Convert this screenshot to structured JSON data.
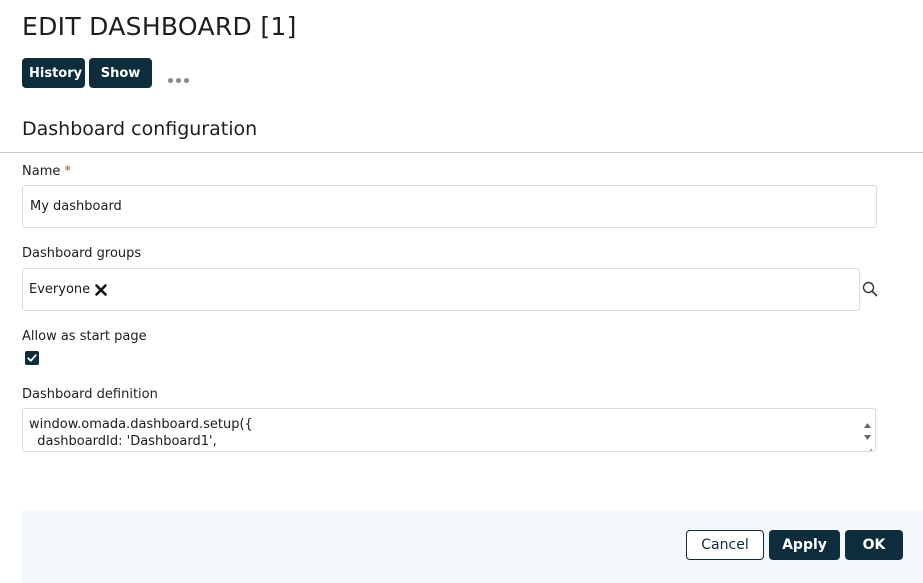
{
  "header": {
    "title": "EDIT DASHBOARD [1]"
  },
  "toolbar": {
    "history_label": "History",
    "show_label": "Show",
    "more_icon": "more-horizontal-icon"
  },
  "section": {
    "title": "Dashboard configuration"
  },
  "form": {
    "name": {
      "label": "Name",
      "required_marker": "*",
      "value": "My dashboard"
    },
    "groups": {
      "label": "Dashboard groups",
      "chips": [
        {
          "label": "Everyone",
          "remove_icon": "close-icon"
        }
      ],
      "search_icon": "search-icon"
    },
    "start_page": {
      "label": "Allow as start page",
      "checked": true
    },
    "definition": {
      "label": "Dashboard definition",
      "lines": [
        "window.omada.dashboard.setup({",
        "  dashboardId: 'Dashboard1',"
      ]
    }
  },
  "footer": {
    "cancel_label": "Cancel",
    "apply_label": "Apply",
    "ok_label": "OK"
  },
  "colors": {
    "primary": "#0d2d3d",
    "footer_bg": "#f4f8fc",
    "required": "#c0392b"
  }
}
